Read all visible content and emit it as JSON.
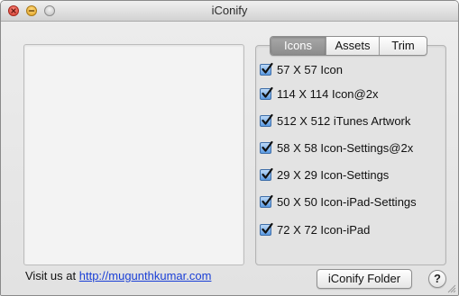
{
  "window": {
    "title": "iConify"
  },
  "tabs": [
    {
      "label": "Icons",
      "selected": true
    },
    {
      "label": "Assets",
      "selected": false
    },
    {
      "label": "Trim",
      "selected": false
    }
  ],
  "icon_options": [
    {
      "label": "57 X 57 Icon",
      "checked": true
    },
    {
      "label": "114 X 114 Icon@2x",
      "checked": true
    },
    {
      "label": "512 X 512 iTunes Artwork",
      "checked": true
    },
    {
      "label": "58 X 58 Icon-Settings@2x",
      "checked": true
    },
    {
      "label": "29 X 29 Icon-Settings",
      "checked": true
    },
    {
      "label": "50 X 50 Icon-iPad-Settings",
      "checked": true
    },
    {
      "label": "72 X 72 Icon-iPad",
      "checked": true
    }
  ],
  "footer": {
    "visit_text": "Visit us at",
    "link_text": "http://mugunthkumar.com",
    "folder_button": "iConify Folder",
    "help_button": "?"
  },
  "colors": {
    "link": "#1a3fd6",
    "checkbox": "#5b9ae2",
    "active_tab": "#8c8c8c"
  }
}
